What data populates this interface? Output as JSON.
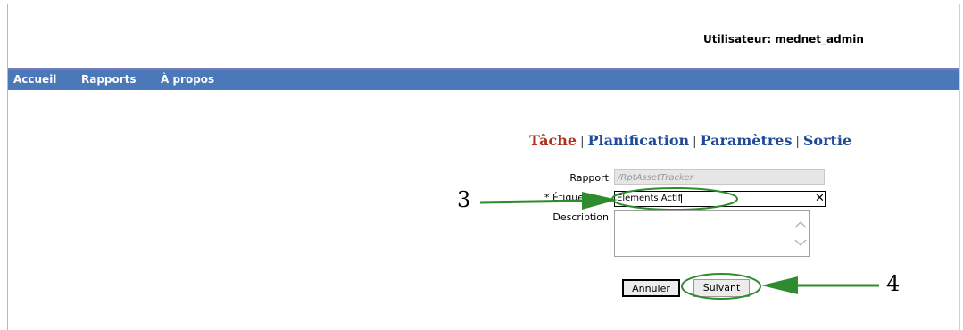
{
  "header": {
    "user_label": "Utilisateur: mednet_admin"
  },
  "nav": {
    "items": [
      "Accueil",
      "Rapports",
      "À propos"
    ]
  },
  "steps": {
    "active": "Tâche",
    "links": [
      "Planification",
      "Paramètres",
      "Sortie"
    ],
    "separator": "|"
  },
  "form": {
    "rapport_label": "Rapport",
    "rapport_value": "/RptAssetTracker",
    "etiquette_label": "* Étiquette",
    "etiquette_value": "Elements Actif",
    "description_label": "Description"
  },
  "buttons": {
    "cancel": "Annuler",
    "next": "Suivant"
  },
  "annotations": {
    "step3": "3",
    "step4": "4"
  },
  "colors": {
    "nav_bg": "#4a78b8",
    "active_step": "#b03020",
    "link_step": "#1f4b99",
    "annotation": "#2e8b2e"
  },
  "icons": [
    "clear-x-icon",
    "scroll-up-icon",
    "scroll-down-icon",
    "arrow-annotation-icon"
  ]
}
